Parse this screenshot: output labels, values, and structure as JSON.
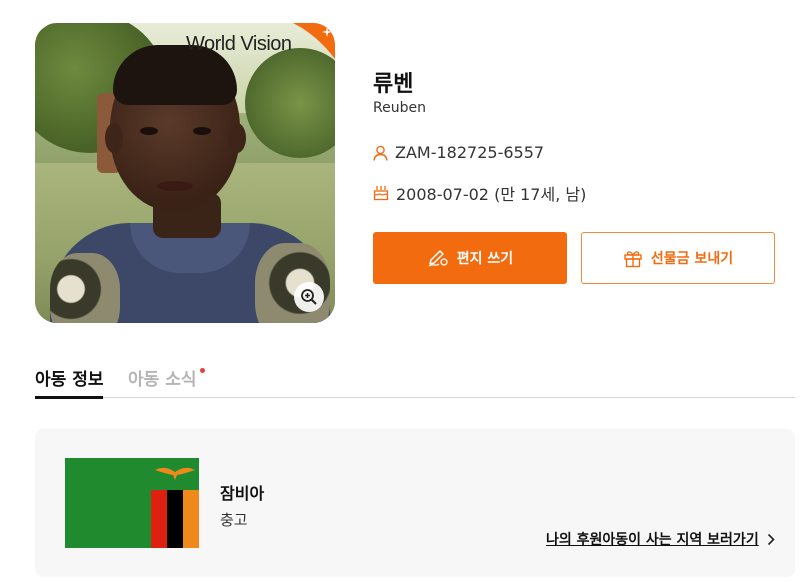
{
  "child": {
    "name_korean": "류벤",
    "name_english": "Reuben",
    "child_id": "ZAM-182725-6557",
    "birthday": "2008-07-02 (만 17세, 남)"
  },
  "photo": {
    "logo_text": "World Vision"
  },
  "actions": {
    "write_letter_label": "편지 쓰기",
    "send_gift_label": "선물금 보내기"
  },
  "tabs": [
    {
      "label": "아동 정보",
      "active": true
    },
    {
      "label": "아동 소식",
      "active": false,
      "has_notification": true
    }
  ],
  "country": {
    "name": "잠비아",
    "region": "충고",
    "link_label": "나의 후원아동이 사는 지역 보러가기"
  },
  "colors": {
    "accent": "#f26b0f",
    "notification_dot": "#e8413a"
  },
  "icons": {
    "id": "person-icon",
    "birthday": "cake-icon",
    "letter": "pen-icon",
    "gift": "gift-icon",
    "zoom": "zoom-in-icon",
    "link": "chevron-right-icon"
  }
}
